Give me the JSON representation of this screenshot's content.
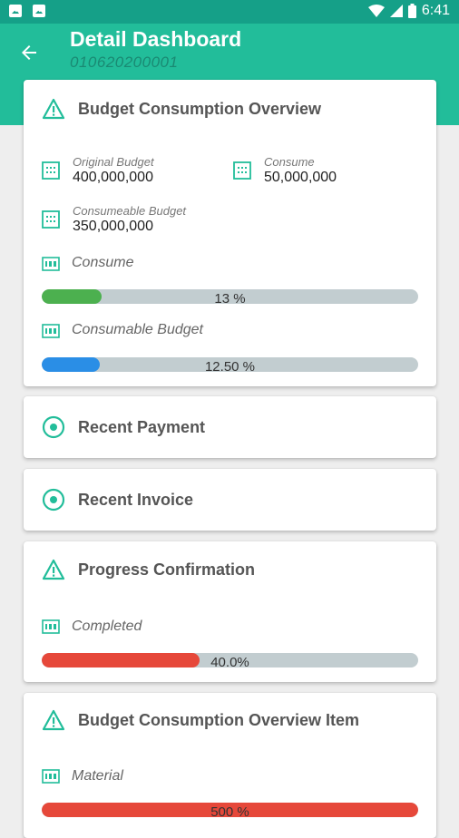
{
  "status": {
    "time": "6:41"
  },
  "header": {
    "title": "Detail Dashboard",
    "subtitle": "010620200001"
  },
  "colors": {
    "primary": "#22bd9a",
    "green": "#4cb04f",
    "blue": "#2a8ee6",
    "red": "#e6483a"
  },
  "budget": {
    "title": "Budget Consumption Overview",
    "original_label": "Original Budget",
    "original_value": "400,000,000",
    "consume_label": "Consume",
    "consume_value": "50,000,000",
    "consumeable_label": "Consumeable Budget",
    "consumeable_value": "350,000,000",
    "bar1_label": "Consume",
    "bar1_text": "13 %",
    "bar1_fraction": 0.16,
    "bar2_label": "Consumable Budget",
    "bar2_text": "12.50 %",
    "bar2_fraction": 0.155
  },
  "recent_payment": {
    "title": "Recent Payment"
  },
  "recent_invoice": {
    "title": "Recent Invoice"
  },
  "progress": {
    "title": "Progress Confirmation",
    "label": "Completed",
    "text": "40.0%",
    "fraction": 0.42
  },
  "item": {
    "title": "Budget Consumption Overview Item",
    "label": "Material",
    "text": "500 %",
    "fraction": 1.0
  }
}
